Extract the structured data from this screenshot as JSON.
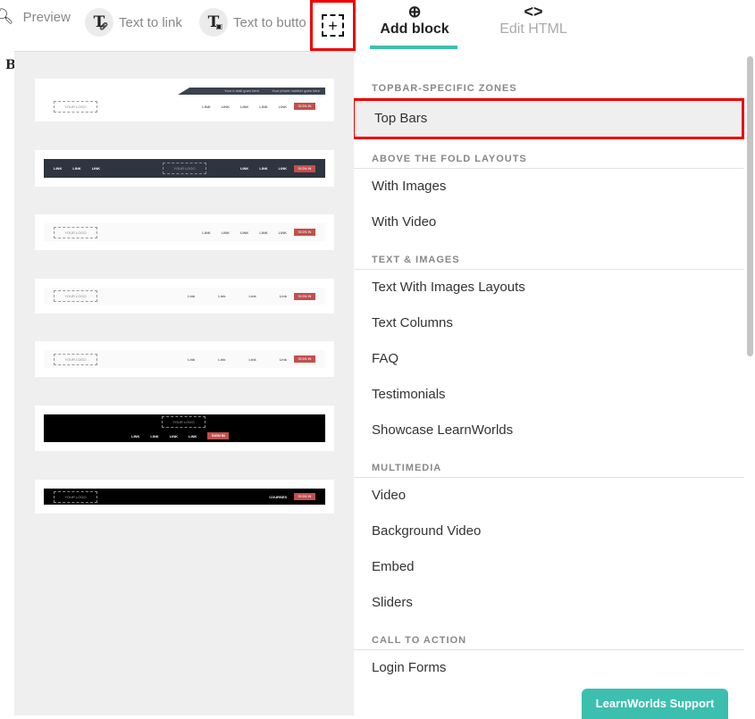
{
  "toolbar": {
    "preview_label": "Preview",
    "text_to_link_label": "Text to link",
    "text_to_button_label": "Text to butto",
    "add_block_label": "Add block",
    "edit_html_label": "Edit HTML"
  },
  "left_strip_char": "B",
  "thumbs": {
    "logo_text": "YOUR LOGO",
    "link_text": "LINK",
    "link_text_lower": "Link",
    "signin_text": "SIGN IN",
    "courses_text": "COURSES",
    "topline_email": "Your e-mail goes here",
    "topline_phone": "Your phone number goes here"
  },
  "menu": {
    "sections": [
      {
        "heading": "TOPBAR-SPECIFIC ZONES",
        "items": [
          "Top Bars"
        ]
      },
      {
        "heading": "ABOVE THE FOLD LAYOUTS",
        "items": [
          "With Images",
          "With Video"
        ]
      },
      {
        "heading": "TEXT & IMAGES",
        "items": [
          "Text With Images Layouts",
          "Text Columns",
          "FAQ",
          "Testimonials",
          "Showcase LearnWorlds"
        ]
      },
      {
        "heading": "MULTIMEDIA",
        "items": [
          "Video",
          "Background Video",
          "Embed",
          "Sliders"
        ]
      },
      {
        "heading": "CALL TO ACTION",
        "items": [
          "Login Forms"
        ]
      }
    ]
  },
  "support_label": "LearnWorlds Support",
  "colors": {
    "accent": "#3dbfb0",
    "highlight_border": "#e00000",
    "signin": "#c0504d",
    "dark_bar": "#2e3440"
  }
}
